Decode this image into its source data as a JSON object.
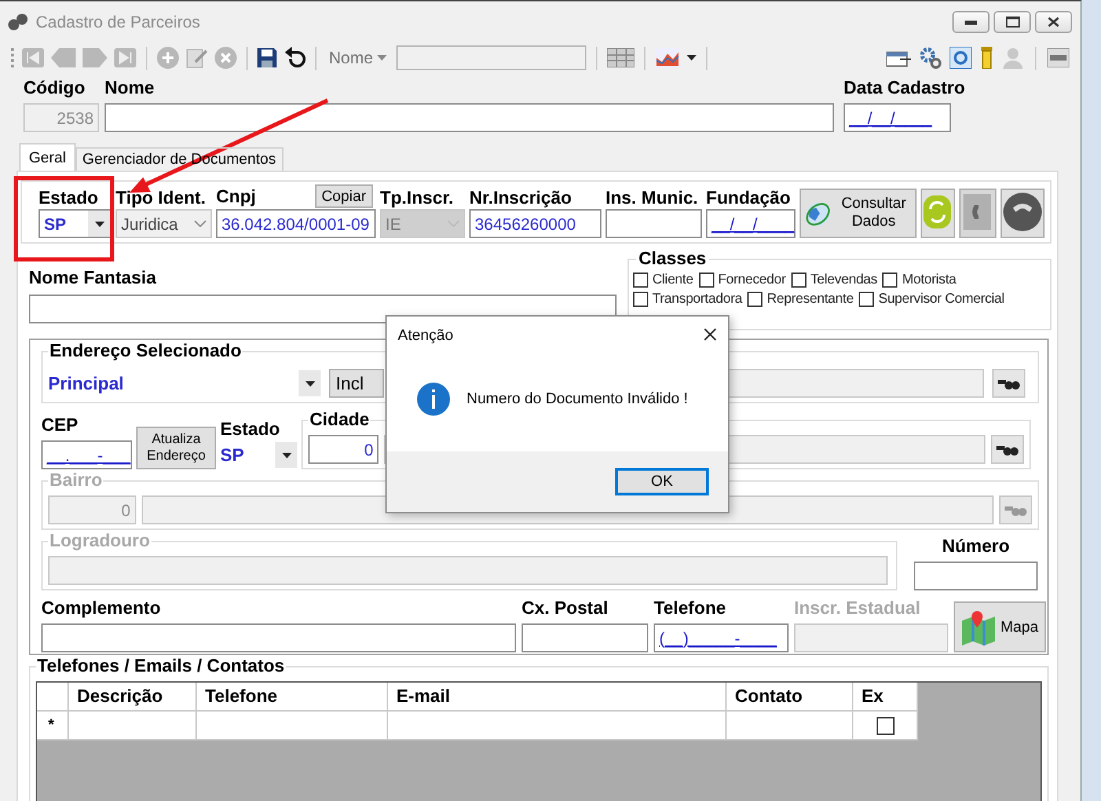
{
  "window": {
    "title": "Cadastro de Parceiros"
  },
  "toolbar": {
    "search_field_label": "Nome"
  },
  "header": {
    "code_label": "Código",
    "code": "2538",
    "name_label": "Nome",
    "date_label": "Data Cadastro",
    "date": "__/__/____"
  },
  "tabs": [
    {
      "label": "Geral",
      "selected": true
    },
    {
      "label": "Gerenciador de Documentos",
      "selected": false
    }
  ],
  "identification": {
    "state": {
      "label": "Estado",
      "value": "SP"
    },
    "id_type": {
      "label": "Tipo Ident.",
      "value": "Juridica",
      "disabled": true
    },
    "cnpj": {
      "label": "Cnpj",
      "value": "36.042.804/0001-09",
      "copy_button": "Copiar"
    },
    "registration_type": {
      "label": "Tp.Inscr.",
      "value": "IE",
      "disabled": true
    },
    "registration_number": {
      "label": "Nr.Inscrição",
      "value": "36456260000"
    },
    "municipal_registration": {
      "label": "Ins. Munic."
    },
    "foundation": {
      "label": "Fundação",
      "value": "__/__/____"
    },
    "lookup_button": "Consultar Dados"
  },
  "trade_name": {
    "label": "Nome Fantasia"
  },
  "classes": {
    "title": "Classes",
    "items": [
      {
        "label": "Cliente",
        "checked": false
      },
      {
        "label": "Fornecedor",
        "checked": false
      },
      {
        "label": "Televendas",
        "checked": false
      },
      {
        "label": "Motorista",
        "checked": false
      },
      {
        "label": "Transportadora",
        "checked": false
      },
      {
        "label": "Representante",
        "checked": false
      },
      {
        "label": "Supervisor Comercial",
        "checked": false
      }
    ]
  },
  "address": {
    "selected": {
      "label": "Endereço Selecionado",
      "value": "Principal",
      "button": "Incl"
    },
    "cep": {
      "label": "CEP",
      "value": "__.___-___"
    },
    "update_button": "Atualiza Endereço",
    "state": {
      "label": "Estado",
      "value": "SP"
    },
    "city": {
      "label": "Cidade",
      "code": "0"
    },
    "district": {
      "label": "Bairro",
      "code": "0",
      "disabled": true
    },
    "street": {
      "label": "Logradouro",
      "disabled": true
    },
    "number": {
      "label": "Número"
    },
    "complement": {
      "label": "Complemento"
    },
    "po_box": {
      "label": "Cx. Postal"
    },
    "phone": {
      "label": "Telefone",
      "value": "(__)_____-____"
    },
    "state_registration": {
      "label": "Inscr. Estadual",
      "disabled": true
    },
    "map_button": "Mapa"
  },
  "contacts": {
    "title": "Telefones / Emails / Contatos",
    "columns": [
      "Descrição",
      "Telefone",
      "E-mail",
      "Contato",
      "Ex"
    ],
    "new_row": {
      "marker": "*",
      "ex_checked": false
    }
  },
  "dialog": {
    "title": "Atenção",
    "message": "Numero do Documento Inválido !",
    "button": "OK"
  }
}
